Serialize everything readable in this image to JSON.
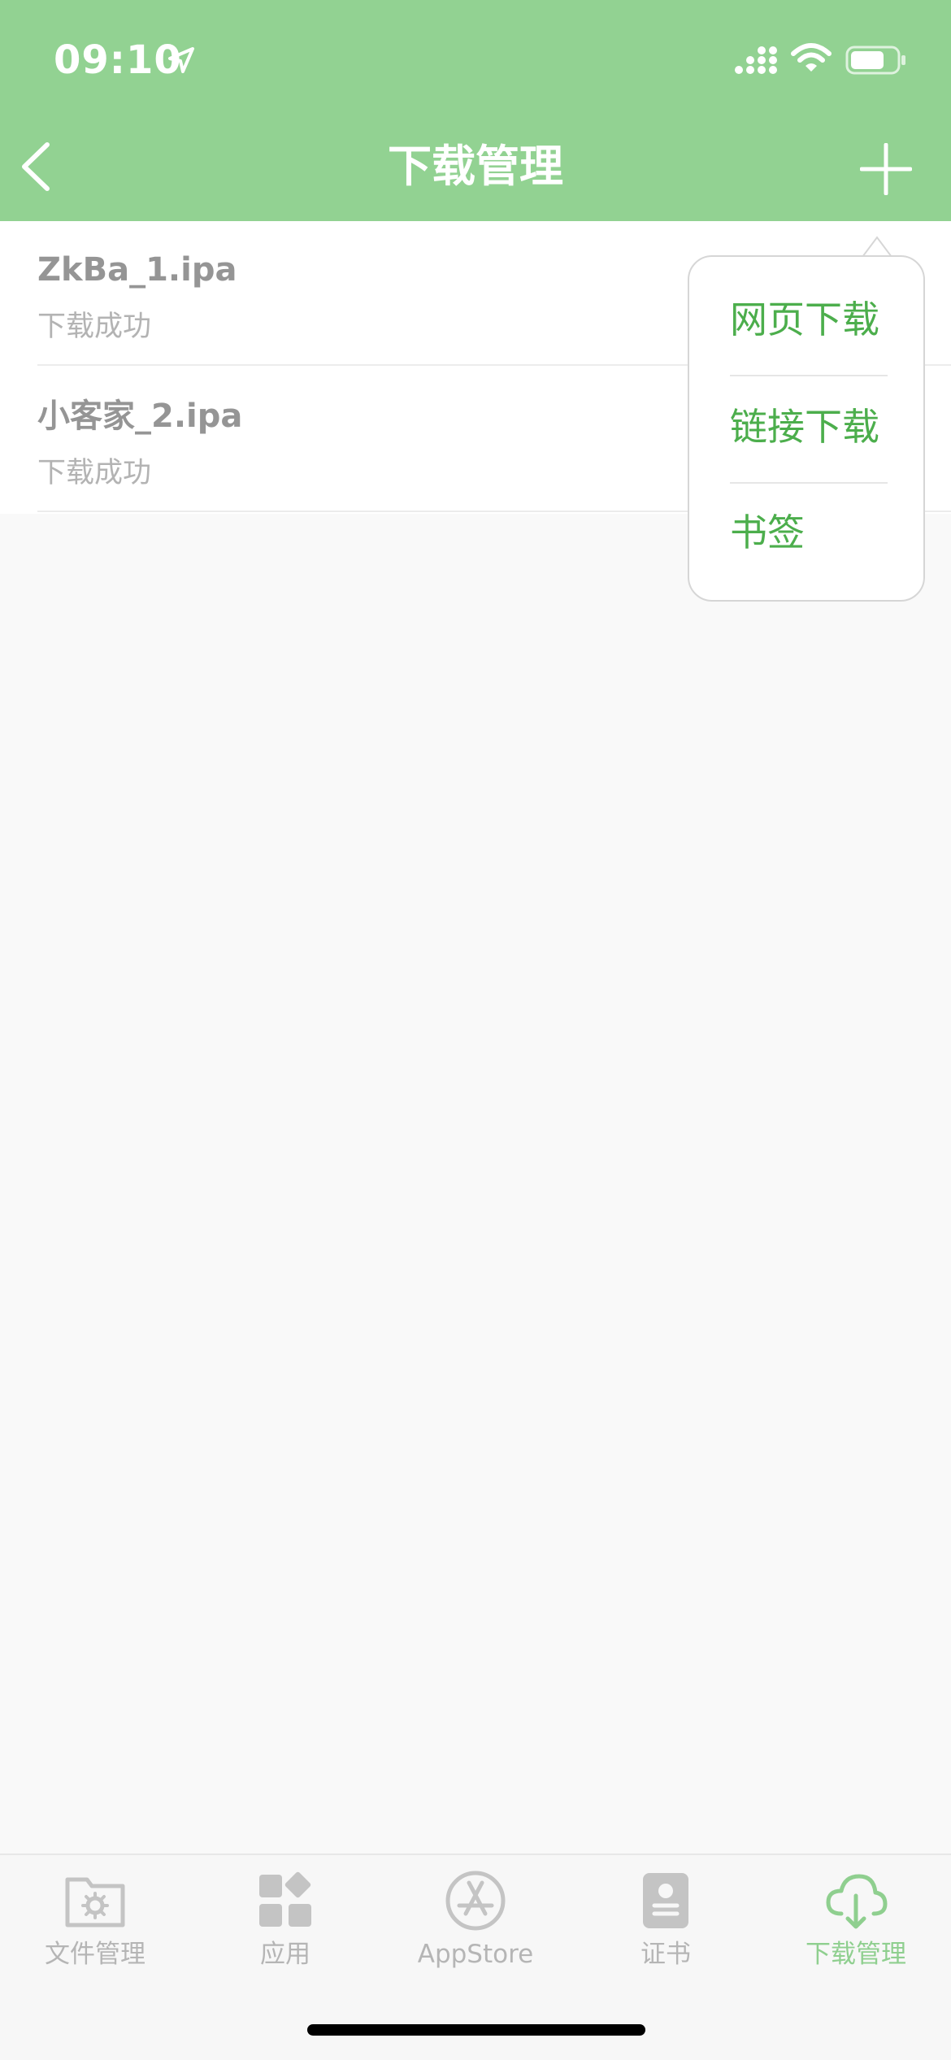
{
  "status_bar": {
    "time": "09:10"
  },
  "nav": {
    "title": "下载管理",
    "back_icon": "chevron-left-icon",
    "add_icon": "plus-icon"
  },
  "downloads": [
    {
      "name": "ZkBa_1.ipa",
      "status": "下载成功"
    },
    {
      "name": "小客家_2.ipa",
      "status": "下载成功"
    }
  ],
  "popover_menu": {
    "items": [
      {
        "label": "网页下载"
      },
      {
        "label": "链接下载"
      },
      {
        "label": "书签"
      }
    ]
  },
  "tabbar": {
    "tabs": [
      {
        "label": "文件管理",
        "icon": "folder-gear-icon"
      },
      {
        "label": "应用",
        "icon": "apps-grid-icon"
      },
      {
        "label": "AppStore",
        "icon": "appstore-icon"
      },
      {
        "label": "证书",
        "icon": "certificate-icon"
      },
      {
        "label": "下载管理",
        "icon": "cloud-download-icon",
        "active": true
      }
    ]
  },
  "colors": {
    "header": "#92d292",
    "accent": "#4cae4c",
    "tab_active": "#8fcf8f",
    "tab_inactive": "#b5b5b5"
  }
}
